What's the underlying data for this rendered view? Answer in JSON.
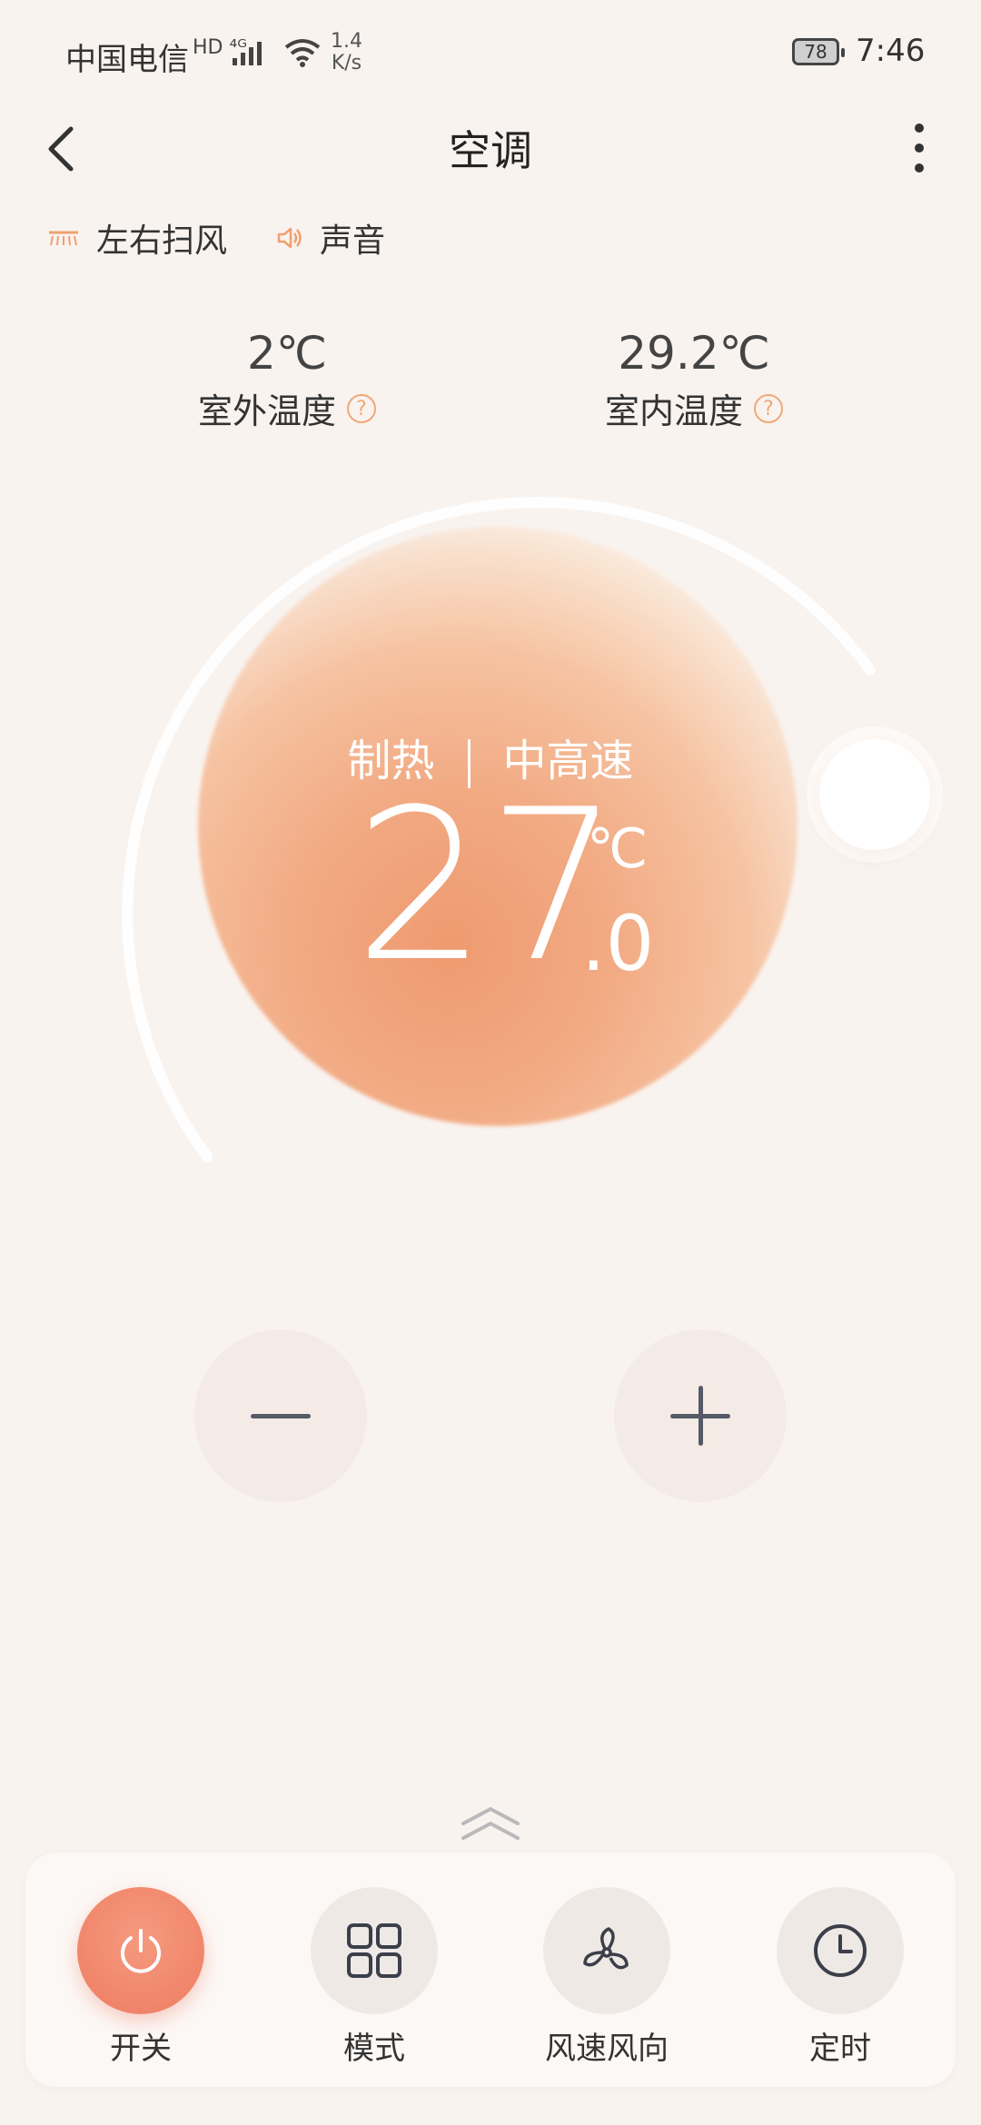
{
  "status_bar": {
    "carrier": "中国电信",
    "badges": "HD ⁴ᴳ",
    "net_speed_value": "1.4",
    "net_speed_unit": "K/s",
    "battery": "78",
    "time": "7:46"
  },
  "header": {
    "title": "空调"
  },
  "toggles": {
    "swing_label": "左右扫风",
    "sound_label": "声音"
  },
  "temps": {
    "outdoor_value": "2℃",
    "outdoor_label": "室外温度",
    "indoor_value": "29.2℃",
    "indoor_label": "室内温度",
    "help_glyph": "?"
  },
  "dial": {
    "mode": "制热",
    "fan_speed": "中高速",
    "set_temp_int": "27",
    "set_temp_unit": "℃",
    "set_temp_dec": ".0"
  },
  "controls": [
    {
      "label": "开关",
      "icon": "power-icon",
      "active": true
    },
    {
      "label": "模式",
      "icon": "grid-icon",
      "active": false
    },
    {
      "label": "风速风向",
      "icon": "fan-icon",
      "active": false
    },
    {
      "label": "定时",
      "icon": "clock-icon",
      "active": false
    }
  ],
  "colors": {
    "accent": "#ee7c62",
    "orb": "#f2ab84",
    "background": "#f9f3ef"
  }
}
